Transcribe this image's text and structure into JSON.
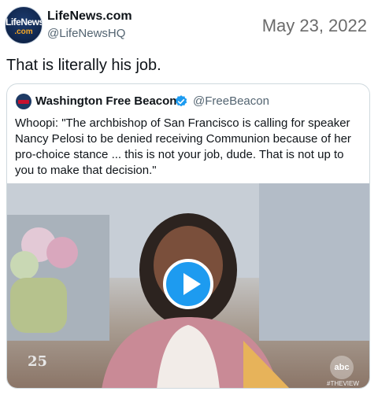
{
  "author": {
    "avatar_text_top": "LifeNews",
    "avatar_text_bottom": ".com",
    "name": "LifeNews.com",
    "handle": "@LifeNewsHQ",
    "avatar_icon": "lifenews-logo-icon"
  },
  "date": "May 23, 2022",
  "tweet_text": "That is literally his job.",
  "quoted": {
    "avatar_icon": "washington-free-beacon-logo-icon",
    "name": "Washington Free Beacon",
    "verified": true,
    "handle": "@FreeBeacon",
    "text": "Whoopi: \"The archbishop of San Francisco is calling for speaker Nancy Pelosi to be denied receiving Communion because of her pro-choice stance ... this is not your job, dude. That is not up to you to make that decision.\""
  },
  "video": {
    "play_icon": "play-icon",
    "bug_left": "25",
    "bug_network": "abc",
    "bug_show": "#THEVIEW"
  },
  "colors": {
    "accent": "#1d9bf0",
    "text": "#0f1419",
    "muted": "#536471",
    "border": "#cfd9de"
  }
}
